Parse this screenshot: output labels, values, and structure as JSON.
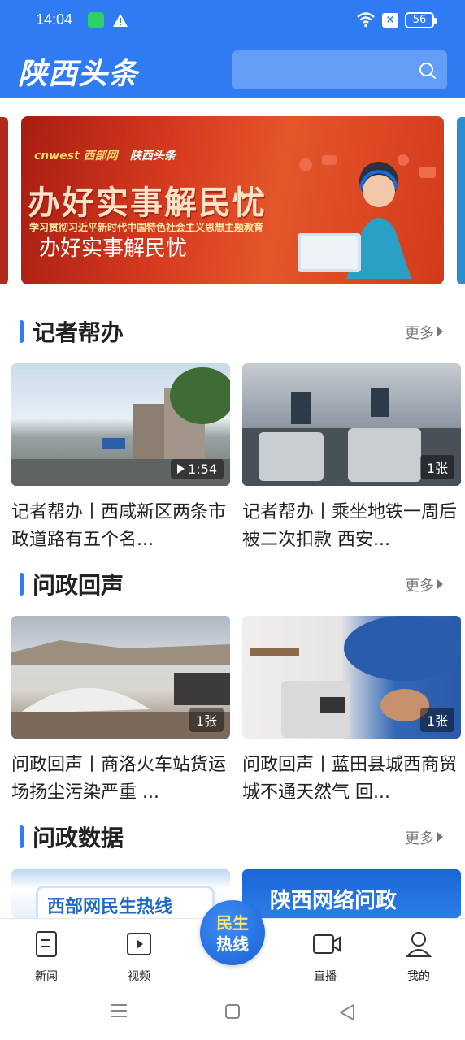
{
  "status_bar": {
    "time": "14:04",
    "battery": "56"
  },
  "header": {
    "logo": "陕西头条",
    "search_placeholder": ""
  },
  "banner": {
    "brand": "cnwest 西部网",
    "brand2": "陕西头条",
    "headline": "办好实事解民忧",
    "subtitle": "学习贯彻习近平新时代中国特色社会主义思想主题教育",
    "caption": "办好实事解民忧"
  },
  "sections": [
    {
      "title": "记者帮办",
      "more": "更多",
      "cards": [
        {
          "title": "记者帮办丨西咸新区两条市政道路有五个名...",
          "badge": "1:54",
          "type": "video"
        },
        {
          "title": "记者帮办丨乘坐地铁一周后被二次扣款  西安...",
          "badge": "1张",
          "type": "image"
        }
      ]
    },
    {
      "title": "问政回声",
      "more": "更多",
      "cards": [
        {
          "title": "问政回声丨商洛火车站货运场扬尘污染严重  ...",
          "badge": "1张",
          "type": "image"
        },
        {
          "title": "问政回声丨蓝田县城西商贸城不通天然气  回...",
          "badge": "1张",
          "type": "image"
        }
      ]
    },
    {
      "title": "问政数据",
      "more": "更多",
      "cards": [
        {
          "title": "西部网民生热线",
          "badge": "",
          "type": "image"
        },
        {
          "title": "陕西网络问政",
          "badge": "",
          "type": "image"
        }
      ]
    }
  ],
  "bottom_nav": {
    "items": [
      {
        "label": "新闻",
        "icon": "news-icon"
      },
      {
        "label": "视频",
        "icon": "video-icon"
      },
      {
        "label": "直播",
        "icon": "live-icon"
      },
      {
        "label": "我的",
        "icon": "profile-icon"
      }
    ],
    "center": {
      "line1": "民生",
      "line2": "热线"
    }
  },
  "colors": {
    "brand_blue": "#2f7cf2",
    "banner_red": "#d63a1f"
  }
}
